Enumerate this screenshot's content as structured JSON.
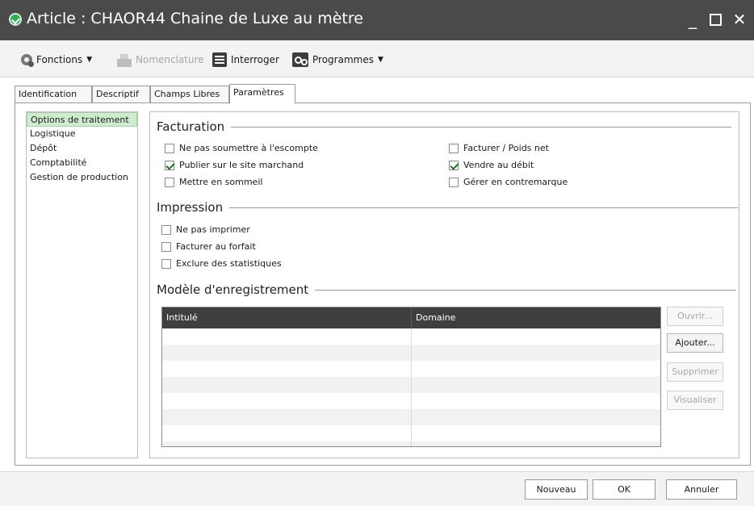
{
  "window": {
    "title": "Article : CHAOR44 Chaine de Luxe au mètre",
    "minimize_glyph": "_",
    "close_glyph": "✕"
  },
  "toolbar": {
    "fonctions": "Fonctions",
    "nomenclature": "Nomenclature",
    "interroger": "Interroger",
    "programmes": "Programmes"
  },
  "tabs": [
    {
      "label": "Identification"
    },
    {
      "label": "Descriptif"
    },
    {
      "label": "Champs Libres"
    },
    {
      "label": "Paramètres",
      "active": true
    }
  ],
  "sidebar": {
    "items": [
      {
        "label": "Options de traitement",
        "selected": true
      },
      {
        "label": "Logistique"
      },
      {
        "label": "Dépôt"
      },
      {
        "label": "Comptabilité"
      },
      {
        "label": "Gestion de production"
      }
    ]
  },
  "facturation": {
    "title": "Facturation",
    "options": [
      {
        "label": "Ne pas soumettre à l'escompte",
        "checked": false
      },
      {
        "label": "Publier sur le site marchand",
        "checked": true
      },
      {
        "label": "Mettre en sommeil",
        "checked": false
      },
      {
        "label": "Facturer / Poids net",
        "checked": false
      },
      {
        "label": "Vendre au débit",
        "checked": true
      },
      {
        "label": "Gérer en contremarque",
        "checked": false
      }
    ]
  },
  "impression": {
    "title": "Impression",
    "options": [
      {
        "label": "Ne pas imprimer",
        "checked": false
      },
      {
        "label": "Facturer au forfait",
        "checked": false
      },
      {
        "label": "Exclure des statistiques",
        "checked": false
      }
    ]
  },
  "modele": {
    "title": "Modèle d'enregistrement",
    "columns": [
      "Intitulé",
      "Domaine"
    ],
    "rows": [],
    "buttons": [
      {
        "label": "Ouvrir...",
        "enabled": false
      },
      {
        "label": "Ajouter...",
        "enabled": true
      },
      {
        "label": "Supprimer",
        "enabled": false
      },
      {
        "label": "Visualiser",
        "enabled": false
      }
    ]
  },
  "footer": {
    "nouveau": "Nouveau",
    "ok": "OK",
    "annuler": "Annuler"
  },
  "colors": {
    "titlebar": "#4a4a4a",
    "selection": "#cfeccf",
    "grid_header": "#3f3f3f"
  }
}
